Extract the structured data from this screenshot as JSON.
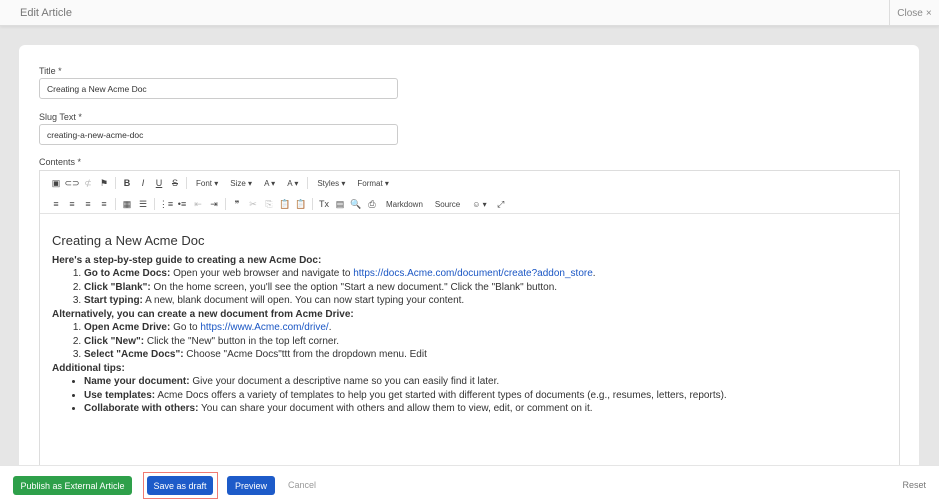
{
  "header": {
    "title": "Edit Article",
    "close_label": "Close",
    "close_icon": "×"
  },
  "form": {
    "title_label": "Title *",
    "title_value": "Creating a New Acme Doc",
    "slug_label": "Slug Text *",
    "slug_value": "creating-a-new-acme-doc",
    "contents_label": "Contents *"
  },
  "toolbar": {
    "row1": [
      "▣",
      "⊂⊃",
      "⊄",
      "⚑",
      "|",
      "B",
      "I",
      "U",
      "S",
      "|",
      "Font ▾",
      "Size ▾",
      "A ▾",
      "A ▾",
      "|",
      "Styles ▾",
      "Format ▾"
    ],
    "row2": [
      "≡",
      "≡",
      "≡",
      "≡",
      "|",
      "▦",
      "☰",
      "|",
      "⋮≡",
      "•≡",
      "⇤",
      "⇥",
      "|",
      "❞",
      "✂",
      "⎘",
      "📋",
      "📋",
      "|",
      "Tx",
      "▤",
      "🔍",
      "⎙",
      "Markdown",
      "Source",
      "☺ ▾",
      "⤢"
    ]
  },
  "content": {
    "heading": "Creating a New Acme Doc",
    "intro": "Here's a step-by-step guide to creating a new Acme Doc:",
    "steps1": [
      {
        "b": "Go to Acme Docs:",
        "t": " Open your web browser and navigate to ",
        "link": "https://docs.Acme.com/document/create?addon_store",
        "after": "."
      },
      {
        "b": "Click \"Blank\":",
        "t": " On the home screen, you'll see the option \"Start a new document.\" Click the \"Blank\" button."
      },
      {
        "b": "Start typing:",
        "t": " A new, blank document will open. You can now start typing your content."
      }
    ],
    "alt": "Alternatively, you can create a new document from Acme Drive:",
    "steps2": [
      {
        "b": "Open Acme Drive:",
        "t": " Go to ",
        "link": "https://www.Acme.com/drive/",
        "after": "."
      },
      {
        "b": "Click \"New\":",
        "t": " Click the \"New\" button in the top left corner."
      },
      {
        "b": "Select \"Acme Docs\":",
        "t": " Choose \"Acme Docs\"ttt from the dropdown menu. Edit"
      }
    ],
    "tips_heading": "Additional tips:",
    "tips": [
      {
        "b": "Name your document:",
        "t": " Give your document a descriptive name so you can easily find it later."
      },
      {
        "b": "Use templates:",
        "t": " Acme Docs offers a variety of templates to help you get started with different types of documents (e.g., resumes, letters, reports)."
      },
      {
        "b": "Collaborate with others:",
        "t": " You can share your document with others and allow them to view, edit, or comment on it."
      }
    ]
  },
  "footer": {
    "publish": "Publish as External Article",
    "draft": "Save as draft",
    "preview": "Preview",
    "cancel": "Cancel",
    "reset": "Reset"
  }
}
